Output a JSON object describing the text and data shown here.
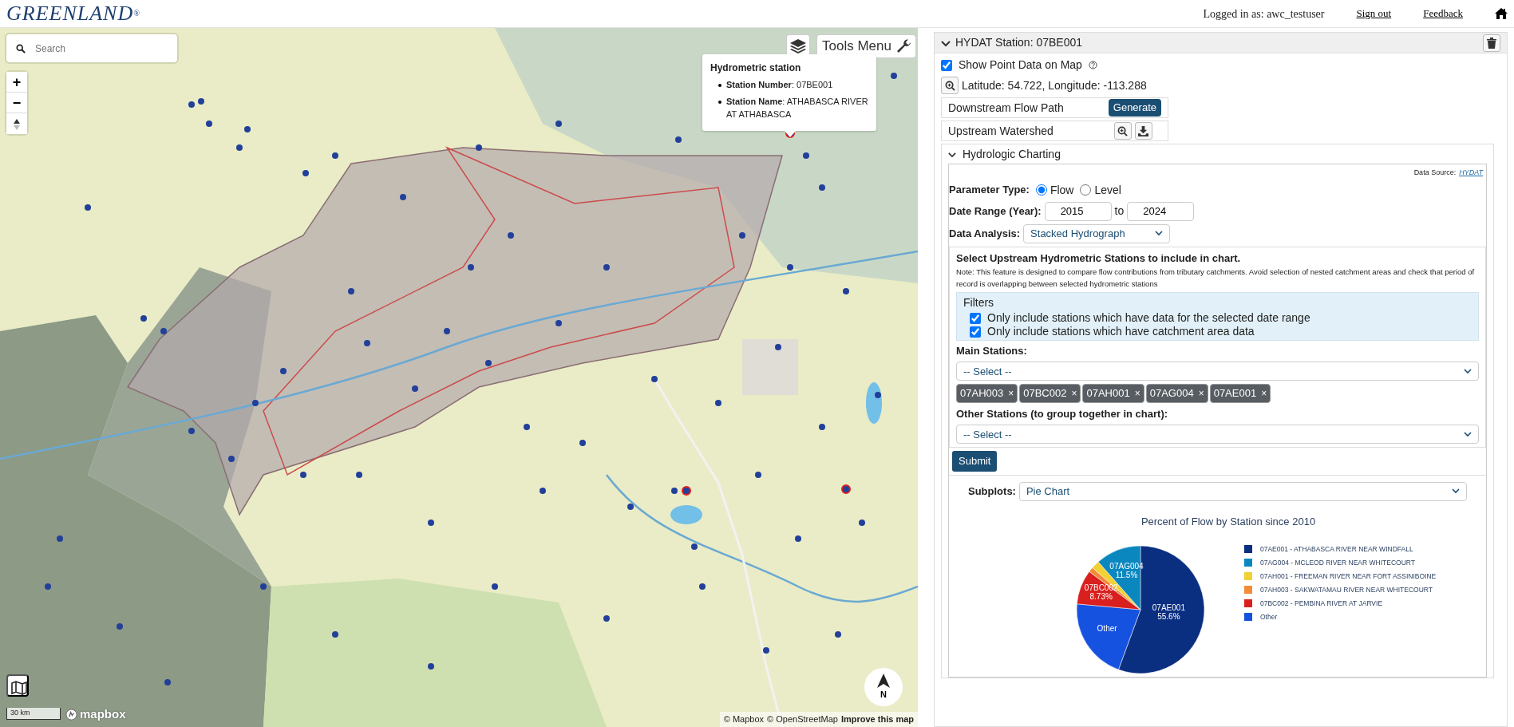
{
  "header": {
    "logo": "GREENLAND$^{®}$",
    "user": "Logged in as: awc_testuser",
    "links": [
      "Sign out",
      "Feedback"
    ]
  },
  "map": {
    "search": {
      "placeholder": "Search"
    },
    "zoom_in": "+",
    "zoom_out": "−",
    "tools_menu": "Tools Menu",
    "popup": {
      "title": "Hydrometric station",
      "items": [
        "**Station Number**: 07BE001",
        "**Station Name**: ATHABASCA RIVER AT ATHABASCA"
      ]
    },
    "scale": "30 km",
    "logo": "mapbox",
    "attribution": [
      "© Mapbox",
      "© OpenStreetMap",
      "Improve this map"
    ],
    "north": "N"
  },
  "panel": {
    "title": "HYDAT Station: 07BE001",
    "expanded": true,
    "show_point": {
      "label": "Show Point Data on Map",
      "checked": true
    },
    "coordinates": "Latitude: 54.722, Longitude: -113.288",
    "downstream": {
      "label": "Downstream Flow Path",
      "button": "Generate"
    },
    "upstream": {
      "label": "Upstream Watershed"
    },
    "charting": {
      "title": "Hydrologic Charting",
      "expanded": true,
      "data_source": {
        "label": "Data Source:",
        "link": "HYDAT"
      },
      "parameter": {
        "label": "Parameter Type:",
        "options": [
          {
            "label": "Flow",
            "selected": true
          },
          {
            "label": "Level",
            "selected": false
          }
        ]
      },
      "date_range": {
        "label": "Date Range (Year):",
        "from": "2015",
        "separator": "to",
        "to": "2024"
      },
      "analysis": {
        "label": "Data Analysis:",
        "value": "Stacked Hydrograph"
      },
      "stations": {
        "title": "Select Upstream Hydrometric Stations to include in chart.",
        "note": "Note: This feature is designed to compare flow contributions from tributary catchments. Avoid selection of nested catchment areas and check that period of record is overlapping between selected hydrometric stations",
        "filters": {
          "title": "Filters",
          "items": [
            {
              "label": "Only include stations which have data for the selected date range",
              "checked": true
            },
            {
              "label": "Only include stations which have catchment area data",
              "checked": true
            }
          ]
        },
        "main_label": "Main Stations:",
        "main_select": "-- Select --",
        "tags": [
          {
            "label": "07AH003",
            "remove": "×"
          },
          {
            "label": "07BC002",
            "remove": "×"
          },
          {
            "label": "07AH001",
            "remove": "×"
          },
          {
            "label": "07AG004",
            "remove": "×"
          },
          {
            "label": "07AE001",
            "remove": "×"
          }
        ],
        "other_label": "Other Stations (to group together in chart):",
        "other_select": "-- Select --"
      },
      "submit": "Submit",
      "subplots": {
        "label": "Subplots:",
        "value": "Pie Chart"
      },
      "chart_data": {
        "type": "pie",
        "title": "Percent of Flow by Station since 2010",
        "categories": [
          "07AE001 - ATHABASCA RIVER NEAR WINDFALL",
          "07AG004 - MCLEOD RIVER NEAR WHITECOURT",
          "07AH001 - FREEMAN RIVER NEAR FORT ASSINIBOINE",
          "07AH003 - SAKWATAMAU RIVER NEAR WHITECOURT",
          "07BC002 - PEMBINA RIVER AT JARVIE",
          "Other"
        ],
        "legend": true,
        "series": [
          {
            "colors": [
              "#0b2f80",
              "#0a87bf",
              "#f2d133",
              "#f28c38",
              "#d9201e",
              "#1652e0"
            ],
            "values": [
              55.6,
              11.5,
              2.06,
              1.27,
              8.73,
              20.84
            ]
          }
        ],
        "value_labels": [
          "07AE001 55.6%",
          "07AG004 11.5%",
          null,
          null,
          "07BC002 8.73%",
          "Other"
        ]
      }
    }
  }
}
